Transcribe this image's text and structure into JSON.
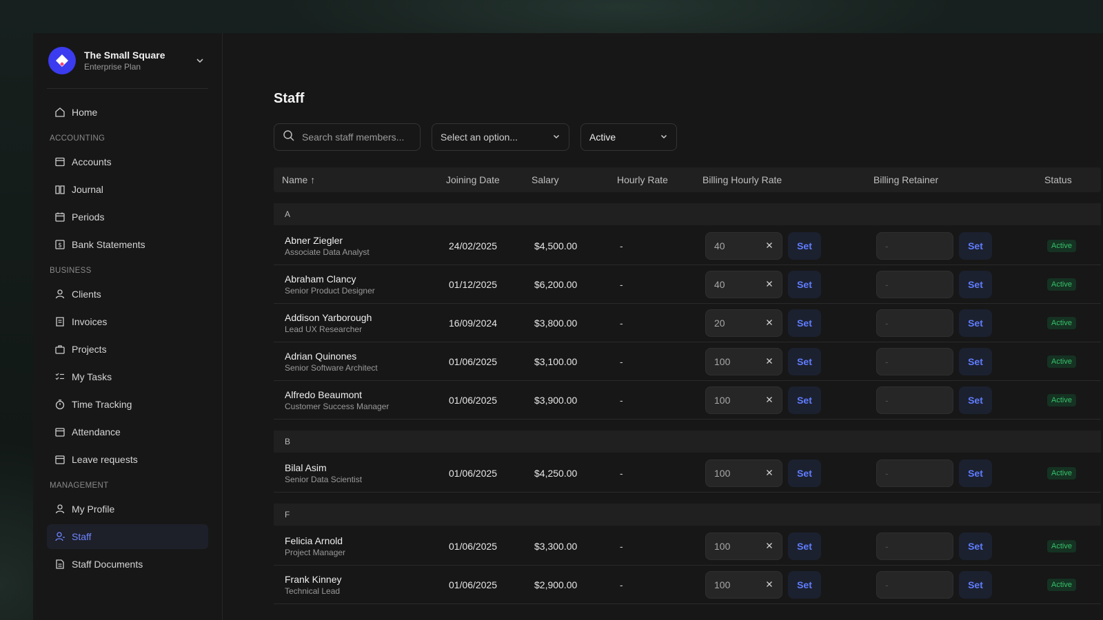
{
  "org": {
    "name": "The Small Square",
    "plan": "Enterprise Plan"
  },
  "nav": {
    "home": "Home",
    "sections": [
      {
        "label": "ACCOUNTING",
        "items": [
          "Accounts",
          "Journal",
          "Periods",
          "Bank Statements"
        ]
      },
      {
        "label": "BUSINESS",
        "items": [
          "Clients",
          "Invoices",
          "Projects",
          "My Tasks",
          "Time Tracking",
          "Attendance",
          "Leave requests"
        ]
      },
      {
        "label": "MANAGEMENT",
        "items": [
          "My Profile",
          "Staff",
          "Staff Documents"
        ]
      }
    ],
    "active": "Staff"
  },
  "page": {
    "title": "Staff"
  },
  "filters": {
    "search_placeholder": "Search staff members...",
    "option_select": "Select an option...",
    "status_select": "Active"
  },
  "table": {
    "headers": {
      "name": "Name",
      "joining_date": "Joining Date",
      "salary": "Salary",
      "hourly_rate": "Hourly Rate",
      "billing_hourly_rate": "Billing Hourly Rate",
      "billing_retainer": "Billing Retainer",
      "status": "Status"
    },
    "set_label": "Set",
    "empty": "-",
    "groups": [
      {
        "letter": "A",
        "rows": [
          {
            "name": "Abner Ziegler",
            "role": "Associate Data Analyst",
            "date": "24/02/2025",
            "salary": "$4,500.00",
            "hourly": "-",
            "billing_rate": "40",
            "retainer": "-",
            "status": "Active"
          },
          {
            "name": "Abraham Clancy",
            "role": "Senior Product Designer",
            "date": "01/12/2025",
            "salary": "$6,200.00",
            "hourly": "-",
            "billing_rate": "40",
            "retainer": "-",
            "status": "Active"
          },
          {
            "name": "Addison Yarborough",
            "role": "Lead UX Researcher",
            "date": "16/09/2024",
            "salary": "$3,800.00",
            "hourly": "-",
            "billing_rate": "20",
            "retainer": "-",
            "status": "Active"
          },
          {
            "name": "Adrian Quinones",
            "role": "Senior Software Architect",
            "date": "01/06/2025",
            "salary": "$3,100.00",
            "hourly": "-",
            "billing_rate": "100",
            "retainer": "-",
            "status": "Active"
          },
          {
            "name": "Alfredo Beaumont",
            "role": "Customer Success Manager",
            "date": "01/06/2025",
            "salary": "$3,900.00",
            "hourly": "-",
            "billing_rate": "100",
            "retainer": "-",
            "status": "Active"
          }
        ]
      },
      {
        "letter": "B",
        "rows": [
          {
            "name": "Bilal Asim",
            "role": "Senior Data Scientist",
            "date": "01/06/2025",
            "salary": "$4,250.00",
            "hourly": "-",
            "billing_rate": "100",
            "retainer": "-",
            "status": "Active"
          }
        ]
      },
      {
        "letter": "F",
        "rows": [
          {
            "name": "Felicia Arnold",
            "role": "Project Manager",
            "date": "01/06/2025",
            "salary": "$3,300.00",
            "hourly": "-",
            "billing_rate": "100",
            "retainer": "-",
            "status": "Active"
          },
          {
            "name": "Frank Kinney",
            "role": "Technical Lead",
            "date": "01/06/2025",
            "salary": "$2,900.00",
            "hourly": "-",
            "billing_rate": "100",
            "retainer": "-",
            "status": "Active"
          }
        ]
      }
    ]
  },
  "colors": {
    "accent": "#5f7dff",
    "active_badge": "#37c06a",
    "logo": "#3b3bf0"
  }
}
